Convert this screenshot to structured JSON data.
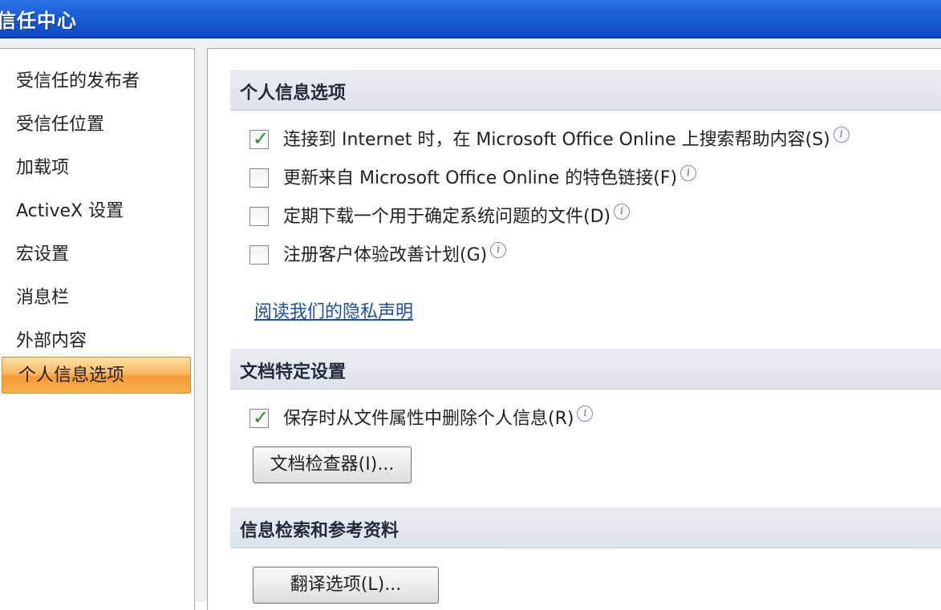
{
  "window": {
    "title": "信任中心"
  },
  "sidebar": {
    "items": [
      {
        "label": "受信任的发布者"
      },
      {
        "label": "受信任位置"
      },
      {
        "label": "加载项"
      },
      {
        "label": "ActiveX 设置"
      },
      {
        "label": "宏设置"
      },
      {
        "label": "消息栏"
      },
      {
        "label": "外部内容"
      },
      {
        "label": "个人信息选项",
        "selected": true
      }
    ]
  },
  "main": {
    "personal_section": {
      "title": "个人信息选项",
      "options": [
        {
          "label": "连接到 Internet 时，在 Microsoft Office Online 上搜索帮助内容(S)",
          "checked": true
        },
        {
          "label": "更新来自 Microsoft Office Online 的特色链接(F)",
          "checked": false
        },
        {
          "label": "定期下载一个用于确定系统问题的文件(D)",
          "checked": false
        },
        {
          "label": "注册客户体验改善计划(G)",
          "checked": false
        }
      ],
      "privacy_link": "阅读我们的隐私声明"
    },
    "document_section": {
      "title": "文档特定设置",
      "option": {
        "label": "保存时从文件属性中删除个人信息(R)",
        "checked": true
      },
      "inspector_button": "文档检查器(I)..."
    },
    "research_section": {
      "title": "信息检索和参考资料",
      "translation_button": "翻译选项(L)..."
    }
  },
  "icons": {
    "info": "info-icon",
    "check": "checkmark-icon"
  },
  "colors": {
    "titlebar": "#1a5bd6",
    "selected_item": "#fbb865",
    "link": "#1a4fa0"
  }
}
